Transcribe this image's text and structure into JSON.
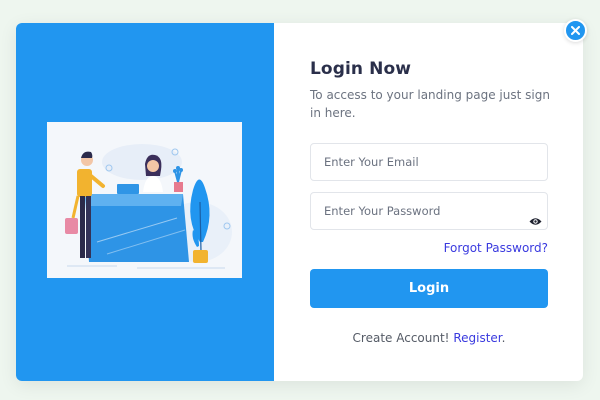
{
  "login": {
    "title": "Login Now",
    "subtitle": "To access to your landing page just sign in here.",
    "email_placeholder": "Enter Your Email",
    "password_placeholder": "Enter Your Password",
    "forgot_label": "Forgot Password?",
    "submit_label": "Login",
    "register_prompt": "Create Account!",
    "register_link": "Register",
    "register_suffix": "."
  },
  "icons": {
    "close": "close-icon",
    "password_toggle": "eye-icon",
    "illustration": "reception-illustration"
  },
  "colors": {
    "accent": "#2196f0",
    "link": "#3a3adf",
    "title": "#2a2f4a",
    "background": "#eef6ef"
  }
}
